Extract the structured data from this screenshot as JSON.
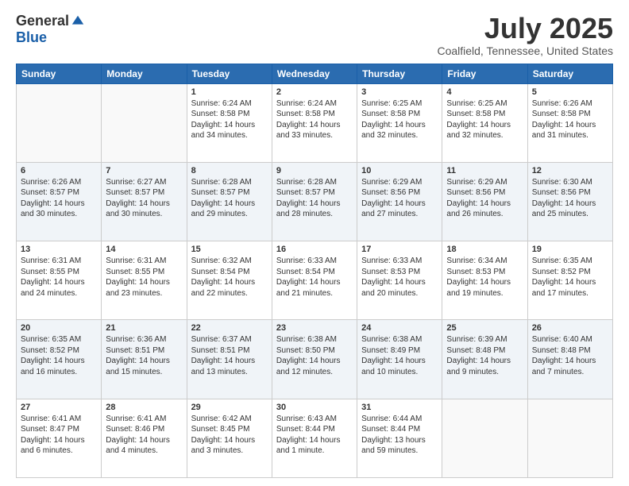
{
  "logo": {
    "general": "General",
    "blue": "Blue"
  },
  "title": "July 2025",
  "location": "Coalfield, Tennessee, United States",
  "days_header": [
    "Sunday",
    "Monday",
    "Tuesday",
    "Wednesday",
    "Thursday",
    "Friday",
    "Saturday"
  ],
  "weeks": [
    [
      {
        "day": "",
        "empty": true
      },
      {
        "day": "",
        "empty": true
      },
      {
        "day": "1",
        "sunrise": "6:24 AM",
        "sunset": "8:58 PM",
        "daylight": "14 hours and 34 minutes."
      },
      {
        "day": "2",
        "sunrise": "6:24 AM",
        "sunset": "8:58 PM",
        "daylight": "14 hours and 33 minutes."
      },
      {
        "day": "3",
        "sunrise": "6:25 AM",
        "sunset": "8:58 PM",
        "daylight": "14 hours and 32 minutes."
      },
      {
        "day": "4",
        "sunrise": "6:25 AM",
        "sunset": "8:58 PM",
        "daylight": "14 hours and 32 minutes."
      },
      {
        "day": "5",
        "sunrise": "6:26 AM",
        "sunset": "8:58 PM",
        "daylight": "14 hours and 31 minutes."
      }
    ],
    [
      {
        "day": "6",
        "sunrise": "6:26 AM",
        "sunset": "8:57 PM",
        "daylight": "14 hours and 30 minutes."
      },
      {
        "day": "7",
        "sunrise": "6:27 AM",
        "sunset": "8:57 PM",
        "daylight": "14 hours and 30 minutes."
      },
      {
        "day": "8",
        "sunrise": "6:28 AM",
        "sunset": "8:57 PM",
        "daylight": "14 hours and 29 minutes."
      },
      {
        "day": "9",
        "sunrise": "6:28 AM",
        "sunset": "8:57 PM",
        "daylight": "14 hours and 28 minutes."
      },
      {
        "day": "10",
        "sunrise": "6:29 AM",
        "sunset": "8:56 PM",
        "daylight": "14 hours and 27 minutes."
      },
      {
        "day": "11",
        "sunrise": "6:29 AM",
        "sunset": "8:56 PM",
        "daylight": "14 hours and 26 minutes."
      },
      {
        "day": "12",
        "sunrise": "6:30 AM",
        "sunset": "8:56 PM",
        "daylight": "14 hours and 25 minutes."
      }
    ],
    [
      {
        "day": "13",
        "sunrise": "6:31 AM",
        "sunset": "8:55 PM",
        "daylight": "14 hours and 24 minutes."
      },
      {
        "day": "14",
        "sunrise": "6:31 AM",
        "sunset": "8:55 PM",
        "daylight": "14 hours and 23 minutes."
      },
      {
        "day": "15",
        "sunrise": "6:32 AM",
        "sunset": "8:54 PM",
        "daylight": "14 hours and 22 minutes."
      },
      {
        "day": "16",
        "sunrise": "6:33 AM",
        "sunset": "8:54 PM",
        "daylight": "14 hours and 21 minutes."
      },
      {
        "day": "17",
        "sunrise": "6:33 AM",
        "sunset": "8:53 PM",
        "daylight": "14 hours and 20 minutes."
      },
      {
        "day": "18",
        "sunrise": "6:34 AM",
        "sunset": "8:53 PM",
        "daylight": "14 hours and 19 minutes."
      },
      {
        "day": "19",
        "sunrise": "6:35 AM",
        "sunset": "8:52 PM",
        "daylight": "14 hours and 17 minutes."
      }
    ],
    [
      {
        "day": "20",
        "sunrise": "6:35 AM",
        "sunset": "8:52 PM",
        "daylight": "14 hours and 16 minutes."
      },
      {
        "day": "21",
        "sunrise": "6:36 AM",
        "sunset": "8:51 PM",
        "daylight": "14 hours and 15 minutes."
      },
      {
        "day": "22",
        "sunrise": "6:37 AM",
        "sunset": "8:51 PM",
        "daylight": "14 hours and 13 minutes."
      },
      {
        "day": "23",
        "sunrise": "6:38 AM",
        "sunset": "8:50 PM",
        "daylight": "14 hours and 12 minutes."
      },
      {
        "day": "24",
        "sunrise": "6:38 AM",
        "sunset": "8:49 PM",
        "daylight": "14 hours and 10 minutes."
      },
      {
        "day": "25",
        "sunrise": "6:39 AM",
        "sunset": "8:48 PM",
        "daylight": "14 hours and 9 minutes."
      },
      {
        "day": "26",
        "sunrise": "6:40 AM",
        "sunset": "8:48 PM",
        "daylight": "14 hours and 7 minutes."
      }
    ],
    [
      {
        "day": "27",
        "sunrise": "6:41 AM",
        "sunset": "8:47 PM",
        "daylight": "14 hours and 6 minutes."
      },
      {
        "day": "28",
        "sunrise": "6:41 AM",
        "sunset": "8:46 PM",
        "daylight": "14 hours and 4 minutes."
      },
      {
        "day": "29",
        "sunrise": "6:42 AM",
        "sunset": "8:45 PM",
        "daylight": "14 hours and 3 minutes."
      },
      {
        "day": "30",
        "sunrise": "6:43 AM",
        "sunset": "8:44 PM",
        "daylight": "14 hours and 1 minute."
      },
      {
        "day": "31",
        "sunrise": "6:44 AM",
        "sunset": "8:44 PM",
        "daylight": "13 hours and 59 minutes."
      },
      {
        "day": "",
        "empty": true
      },
      {
        "day": "",
        "empty": true
      }
    ]
  ]
}
